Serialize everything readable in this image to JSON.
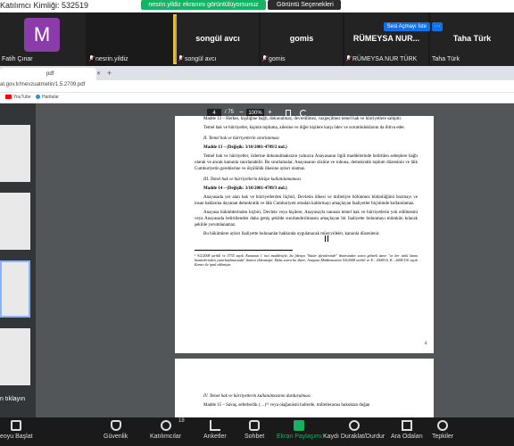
{
  "meeting": {
    "id_label": "Katılımcı Kimliği: 532519"
  },
  "banner": {
    "share_text": "nesrin.yildiz ekranını görüntülüyorsunuz",
    "view_options": "Görüntü Seçenekleri"
  },
  "participants": [
    {
      "name": "Fatih Çınar",
      "avatar_letter": "M",
      "avatar_color": "#8c3bab"
    },
    {
      "name": "nesrin.yildiz",
      "muted": true
    },
    {
      "name": "songül avcı",
      "muted": true
    },
    {
      "name": "gomis",
      "muted": true
    },
    {
      "name": "RÜMEYSA NUR TÜRK",
      "short_name": "RÜMEYSA NUR...",
      "muted": true
    },
    {
      "name": "Taha Türk",
      "muted": false
    }
  ],
  "top_buttons": {
    "unmute_all": "Sesi Açmayı İste",
    "more": "···"
  },
  "browser": {
    "tab_title": "pdf",
    "url": "at.gov.tr/mevzuatmetin/1.5.2709.pdf",
    "bookmarks": [
      {
        "label": "YouTube"
      },
      {
        "label": "Haritalar"
      }
    ]
  },
  "pdf": {
    "current_page": "4",
    "total_pages": "/ 75",
    "zoom": "100%",
    "thumb_click_text": "n tıklayın",
    "page_number": "4",
    "paragraphs": [
      {
        "type": "body",
        "text": "Madde 12 – Herkes, kişiliğine bağlı, dokunulmaz, devredilmez, vazgeçilmez temel hak ve hürriyetlere sahiptir."
      },
      {
        "type": "body",
        "text": "Temel hak ve hürriyetler, kişinin topluma, ailesine ve diğer kişilere karşı ödev ve sorumluluklarını da ihtiva eder."
      },
      {
        "type": "heading",
        "text": "II. Temel hak ve hürriyetlerin sınırlanması"
      },
      {
        "type": "article",
        "text": "Madde 13 – (Değişik: 3/10/2001-4709/2 md.)"
      },
      {
        "type": "body",
        "text": "Temel hak ve hürriyetler, özlerine dokunulmaksızın yalnızca Anayasanın ilgili maddelerinde belirtilen sebeplere bağlı olarak ve ancak kanunla sınırlanabilir. Bu sınırlamalar, Anayasanın sözüne ve ruhuna, demokratik toplum düzeninin ve lâik Cumhuriyetin gereklerine ve ölçülülük ilkesine aykırı olamaz."
      },
      {
        "type": "heading",
        "text": "III. Temel hak ve hürriyetlerin kötüye kullanılamaması"
      },
      {
        "type": "article",
        "text": "Madde 14 – (Değişik: 3/10/2001-4709/3 md.)"
      },
      {
        "type": "body",
        "text": "Anayasada yer alan hak ve hürriyetlerden hiçbiri, Devletin ülkesi ve milletiyle bölünmez bütünlüğünü bozmayı ve insan haklarına dayanan demokratik ve lâik Cumhuriyeti ortadan kaldırmayı amaçlayan faaliyetler biçiminde kullanılamaz."
      },
      {
        "type": "body",
        "text": "Anayasa hükümlerinden hiçbiri, Devlete veya kişilere, Anayasayla tanınan temel hak ve hürriyetlerin yok edilmesini veya Anayasada belirtilenden daha geniş şekilde sınırlandırılmasını amaçlayan bir faaliyette bulunmayı mümkün kılacak şekilde yorumlanamaz."
      },
      {
        "type": "body",
        "text": "Bu hükümlere aykırı faaliyette bulunanlar hakkında uygulanacak müeyyideler, kanunla düzenlenir."
      }
    ],
    "footnote": "¹ 9/2/2008 tarihli ve 5735 sayılı Kanunun 1 inci maddesiyle, bu fıkraya \"bütün işlemlerinde\" ibaresinden sonra gelmek üzere \"ve her türlü kamu hizmetlerinden yararlanılmasında\" ibaresi eklenmiştir. Daha sonra bu ibare; Anayasa Mahkemesinin 5/6/2008 tarihli ve E.: 2008/16, K.: 2008/116 sayılı Kararı ile iptal edilmiştir.",
    "page2": [
      {
        "type": "heading",
        "text": "IV. Temel hak ve hürriyetlerin kullanılmasının durdurulması"
      },
      {
        "type": "body",
        "text": "Madde 15 – Savaş, seferberlik (…)¹² veya olağanüstü hallerde, milletlerarası hukuktan doğan"
      }
    ]
  },
  "toolbar": {
    "items": [
      {
        "label": "Durdurmayı Başlat",
        "short": "eoyu Başlat",
        "icon": "video-icon"
      },
      {
        "label": "Güvenlik",
        "icon": "shield-icon"
      },
      {
        "label": "Katılımcılar",
        "count": "18",
        "icon": "participants-icon"
      },
      {
        "label": "Anketler",
        "icon": "polls-icon"
      },
      {
        "label": "Sohbet",
        "icon": "chat-icon"
      },
      {
        "label": "Ekran Paylaşımı",
        "icon": "share-screen-icon"
      },
      {
        "label": "Kaydı Duraklat/Durdur",
        "icon": "record-icon"
      },
      {
        "label": "Ara Odaları",
        "icon": "breakout-rooms-icon"
      },
      {
        "label": "Tepkiler",
        "icon": "reactions-icon"
      }
    ]
  },
  "colors": {
    "accent": "#0e71eb",
    "share_green": "#16b364",
    "avatar": "#8c3bab"
  }
}
